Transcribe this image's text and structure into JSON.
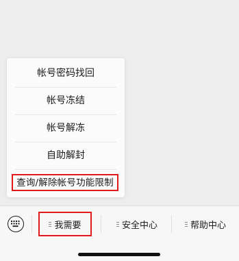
{
  "popup_menu": {
    "items": [
      {
        "label": "帐号密码找回"
      },
      {
        "label": "帐号冻结"
      },
      {
        "label": "帐号解冻"
      },
      {
        "label": "自助解封"
      },
      {
        "label": "查询/解除帐号功能限制",
        "highlighted": true
      }
    ]
  },
  "bottom_bar": {
    "keyboard_icon": "keyboard-icon",
    "tabs": [
      {
        "label": "我需要",
        "icon": "menu-icon",
        "highlighted": true
      },
      {
        "label": "安全中心",
        "icon": "menu-icon"
      },
      {
        "label": "帮助中心",
        "icon": "menu-icon"
      }
    ]
  },
  "colors": {
    "highlight": "#e0191b",
    "background": "#ededed",
    "menu_background": "#fbfbfb",
    "bar_background": "#f7f7f7"
  }
}
